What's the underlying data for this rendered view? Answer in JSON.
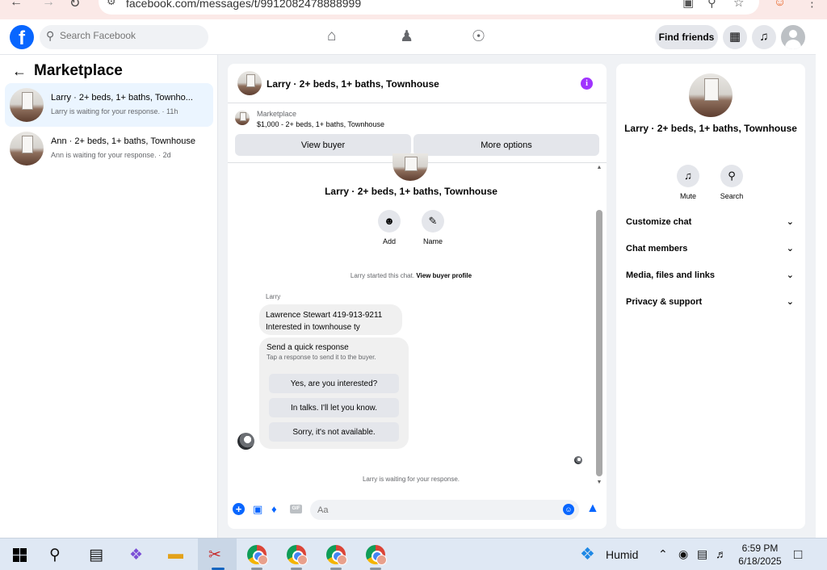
{
  "browser": {
    "url": "facebook.com/messages/t/9912082478888999"
  },
  "header": {
    "search_placeholder": "Search Facebook",
    "find_friends": "Find friends"
  },
  "sidebar": {
    "title": "Marketplace",
    "conversations": [
      {
        "name": "Larry · 2+ beds, 1+ baths, Townho...",
        "subtitle": "Larry is waiting for your response. · 11h",
        "active": true
      },
      {
        "name": "Ann · 2+ beds, 1+ baths, Townhouse",
        "subtitle": "Ann is waiting for your response. · 2d",
        "active": false
      }
    ]
  },
  "chat": {
    "header_title": "Larry · 2+ beds, 1+ baths, Townhouse",
    "listing_category": "Marketplace",
    "listing_title": "$1,000 - 2+ beds, 1+ baths, Townhouse",
    "view_buyer": "View buyer",
    "more_options": "More options",
    "body_title": "Larry · 2+ beds, 1+ baths, Townhouse",
    "actions": {
      "add": "Add",
      "name": "Name"
    },
    "started_text": "Larry started this chat.",
    "view_buyer_profile": "View buyer profile",
    "sender": "Larry",
    "message_line1": "Lawrence Stewart 419-913-9211",
    "message_line2": "Interested in townhouse ty",
    "quick_title": "Send a quick response",
    "quick_subtitle": "Tap a response to send it to the buyer.",
    "quick_responses": [
      "Yes, are you interested?",
      "In talks. I'll let you know.",
      "Sorry, it's not available."
    ],
    "waiting": "Larry is waiting for your response.",
    "input_placeholder": "Aa",
    "gif": "GIF"
  },
  "info_panel": {
    "title": "Larry · 2+ beds, 1+ baths, Townhouse",
    "mute": "Mute",
    "search": "Search",
    "sections": [
      "Customize chat",
      "Chat members",
      "Media, files and links",
      "Privacy & support"
    ]
  },
  "taskbar": {
    "weather": "Humid",
    "time": "6:59 PM",
    "date": "6/18/2025"
  },
  "colors": {
    "fb_blue": "#0866ff",
    "info_purple": "#a033ff",
    "active_conv": "#ebf5ff"
  }
}
